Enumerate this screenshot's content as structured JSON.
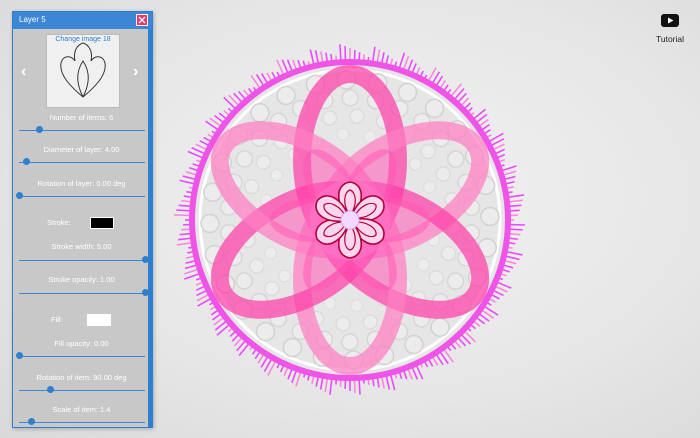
{
  "panel": {
    "title": "Layer 5",
    "change_image_label": "Change image 18",
    "controls": {
      "number_of_items": {
        "label": "Number of items: 6",
        "value": 0.16
      },
      "diameter": {
        "label": "Diameter of layer: 4.00",
        "value": 0.06
      },
      "rotation_layer": {
        "label": "Rotation of layer: 0.00 deg",
        "value": 0.0
      },
      "stroke_label": "Stroke:",
      "stroke_color": "#000000",
      "stroke_width": {
        "label": "Stroke width: 5.00",
        "value": 1.0
      },
      "stroke_opacity": {
        "label": "Stroke opacity: 1.00",
        "value": 1.0
      },
      "fill_label": "Fill:",
      "fill_color": "#ffffff",
      "fill_opacity": {
        "label": "Fill opacity: 0.00",
        "value": 0.0
      },
      "rotation_item": {
        "label": "Rotation of item: 90.00 deg",
        "value": 0.25
      },
      "scale_item": {
        "label": "Scale of item: 1.4",
        "value": 0.1
      }
    }
  },
  "tutorial": {
    "label": "Tutorial",
    "icon": "youtube-play-icon"
  },
  "colors": {
    "accent": "#3b87d6",
    "close": "#e8356a",
    "pink": "#ff3fa8",
    "magenta": "#e84bff"
  }
}
